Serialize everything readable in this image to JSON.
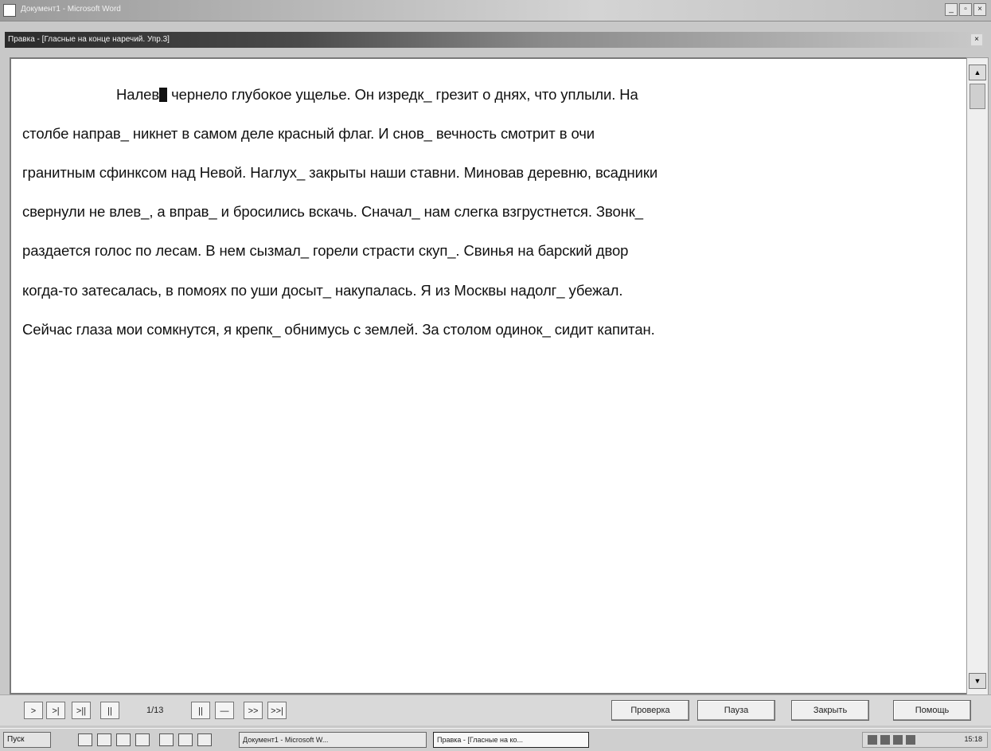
{
  "app": {
    "title": "Документ1 - Microsoft Word",
    "min": "_",
    "max": "▫",
    "close": "×"
  },
  "doc_window": {
    "title": "Правка - [Гласные на конце наречий. Упр.3]",
    "close": "×"
  },
  "document": {
    "line1": "Налев",
    "line1_rest": "чернело глубокое ущелье. Он изредк_ грезит о днях, что уплыли. На",
    "lines": [
      "столбе направ_ никнет в самом деле красный флаг. И снов_ вечность смотрит в очи",
      "гранитным сфинксом над Невой. Наглух_ закрыты наши ставни. Миновав деревню, всадники",
      "свернули не влев_, а вправ_ и бросились вскачь. Сначал_ нам слегка взгрустнется. Звонк_",
      "раздается голос по лесам. В нем сызмал_ горели страсти скуп_. Свинья на барский двор",
      "когда-то затесалась, в помоях по уши досыт_ накупалась. Я из Москвы надолг_ убежал.",
      "Сейчас глаза мои сомкнутся, я крепк_ обнимусь с землей. За столом одинок_ сидит капитан."
    ]
  },
  "scrollbar": {
    "up": "▲",
    "down": "▼"
  },
  "toolbar": {
    "nav": [
      ">",
      ">|",
      ">||",
      "||",
      "||",
      "—",
      ">>",
      ">>|"
    ],
    "page_indicator": "1/13",
    "check": "Проверка",
    "pause": "Пауза",
    "close": "Закрыть",
    "help": "Помощь"
  },
  "taskbar": {
    "start": "Пуск",
    "task1": "Документ1 - Microsoft W...",
    "task2": "Правка - [Гласные на ко...",
    "clock": "15:18"
  }
}
